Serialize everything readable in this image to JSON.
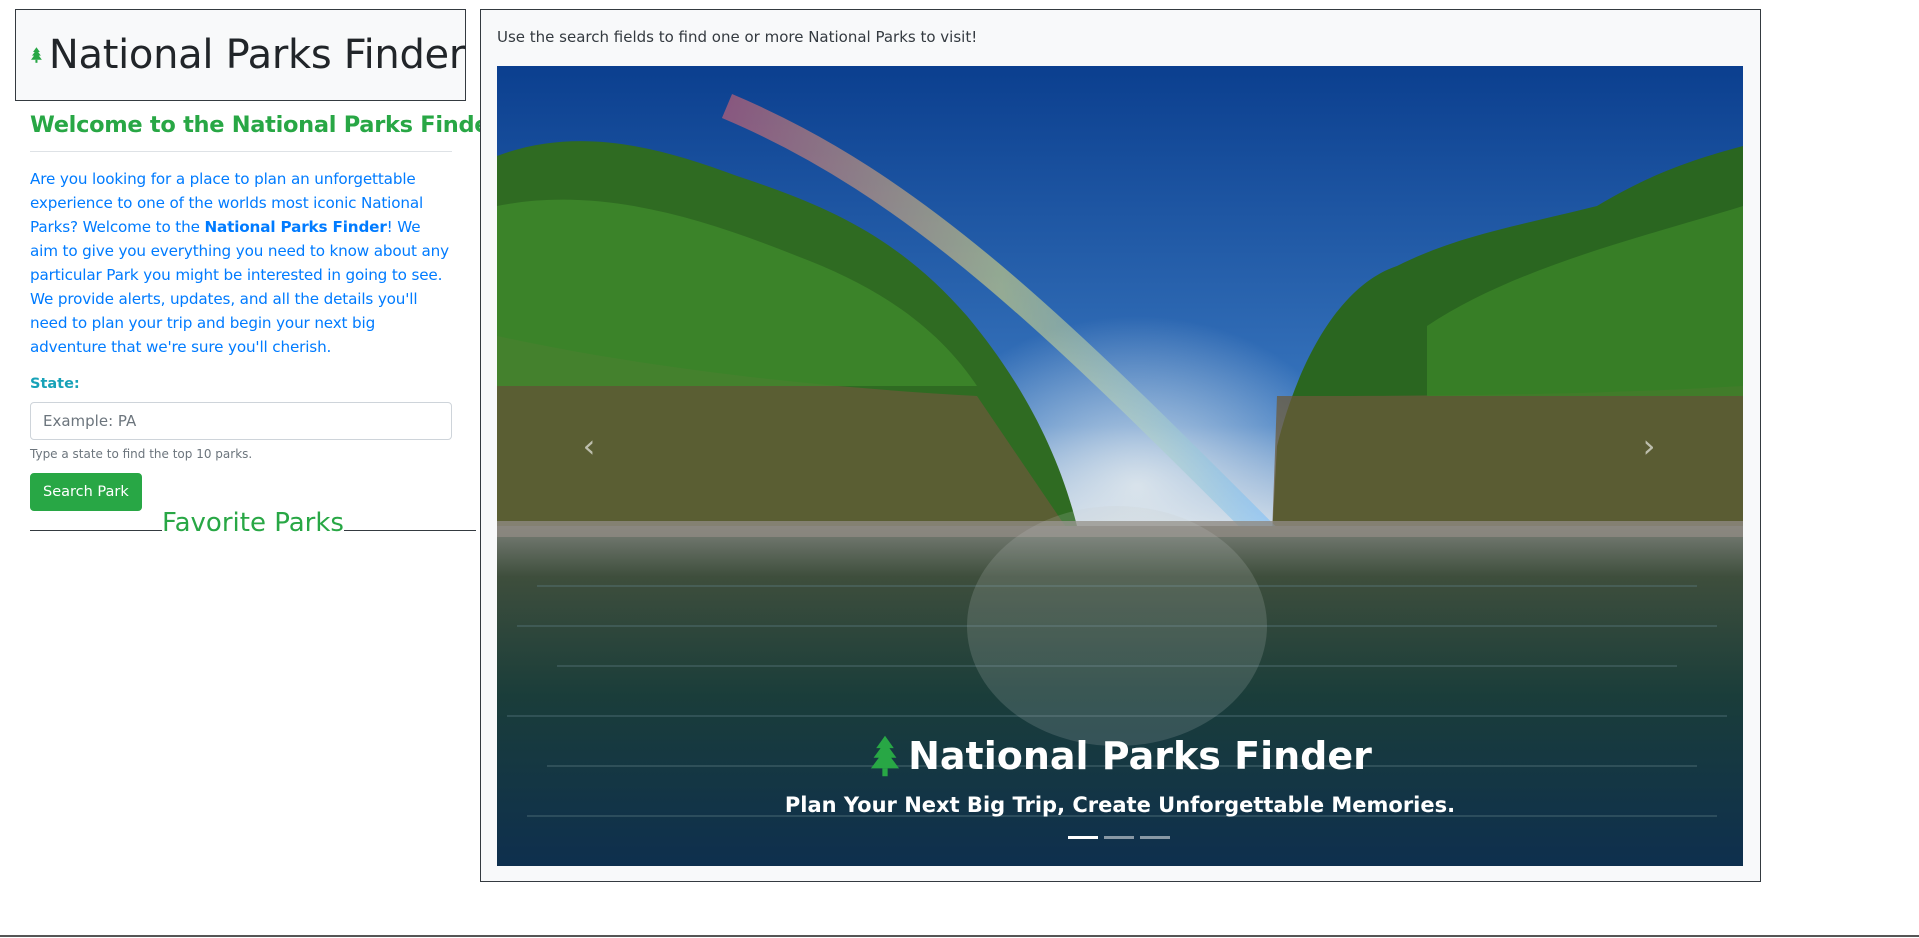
{
  "brand": {
    "title": "National Parks Finder"
  },
  "sidebar": {
    "welcome": "Welcome to the National Parks Finder!",
    "intro_pre": "Are you looking for a place to plan an unforgettable experience to one of the worlds most iconic National Parks? Welcome to the ",
    "intro_bold": "National Parks Finder",
    "intro_post": "! We aim to give you everything you need to know about any particular Park you might be interested in going to see. We provide alerts, updates, and all the details you'll need to plan your trip and begin your next big adventure that we're sure you'll cherish.",
    "state_label": "State:",
    "state_placeholder": "Example: PA",
    "state_help": "Type a state to find the top 10 parks.",
    "search_button": "Search Park",
    "favorites_title": "Favorite Parks"
  },
  "main": {
    "instructions": "Use the search fields to find one or more National Parks to visit!",
    "carousel": {
      "caption_title": "National Parks Finder",
      "caption_subtitle": "Plan Your Next Big Trip, Create Unforgettable Memories.",
      "slide_count": 3,
      "active_slide": 1
    }
  },
  "colors": {
    "brand_green": "#28a745",
    "link_blue": "#007bff",
    "label_teal": "#17a2b8",
    "panel_bg": "#f8f9fa"
  },
  "icons": {
    "tree": "tree-icon",
    "prev": "chevron-left-icon",
    "next": "chevron-right-icon"
  }
}
